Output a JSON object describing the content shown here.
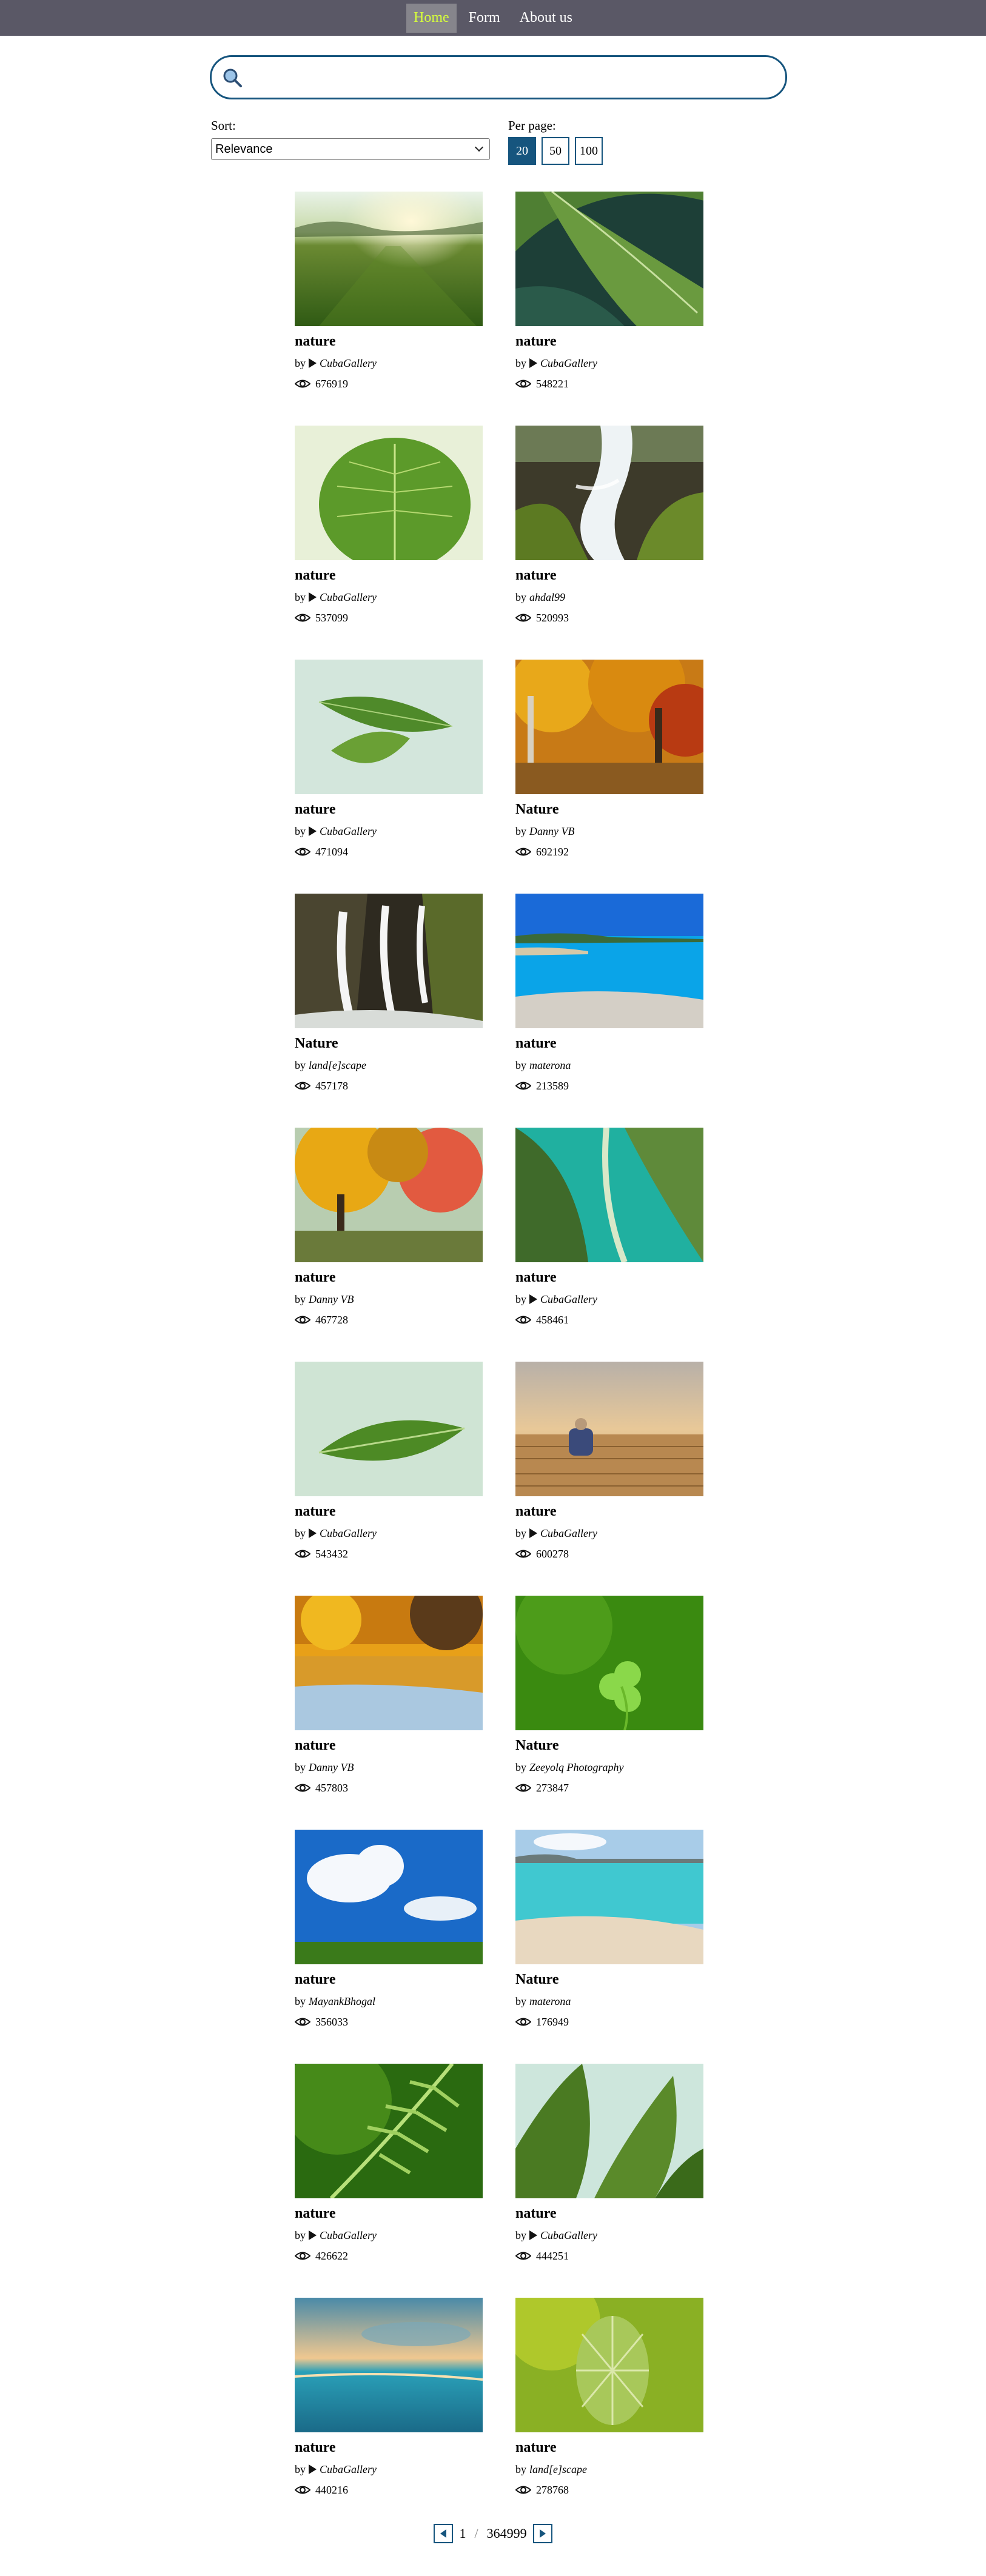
{
  "nav": {
    "items": [
      {
        "label": "Home",
        "active": true
      },
      {
        "label": "Form",
        "active": false
      },
      {
        "label": "About us",
        "active": false
      }
    ]
  },
  "search": {
    "value": "",
    "placeholder": ""
  },
  "controls": {
    "sort_label": "Sort:",
    "sort_value": "Relevance",
    "per_page_label": "Per page:",
    "per_page_options": [
      "20",
      "50",
      "100"
    ],
    "per_page_selected": "20"
  },
  "cards": [
    {
      "title": "nature",
      "by": "by",
      "author": "CubaGallery",
      "author_play_icon": true,
      "views": "676919",
      "image": "meadow-sunrise"
    },
    {
      "title": "nature",
      "by": "by",
      "author": "CubaGallery",
      "author_play_icon": true,
      "views": "548221",
      "image": "leaf-closeup-teal"
    },
    {
      "title": "nature",
      "by": "by",
      "author": "CubaGallery",
      "author_play_icon": true,
      "views": "537099",
      "image": "green-leaf-backlit"
    },
    {
      "title": "nature",
      "by": "by",
      "author": "ahdal99",
      "author_play_icon": false,
      "views": "520993",
      "image": "waterfall-mossy"
    },
    {
      "title": "nature",
      "by": "by",
      "author": "CubaGallery",
      "author_play_icon": true,
      "views": "471094",
      "image": "leaves-on-white"
    },
    {
      "title": "Nature",
      "by": "by",
      "author": "Danny VB",
      "author_play_icon": false,
      "views": "692192",
      "image": "autumn-forest"
    },
    {
      "title": "Nature",
      "by": "by",
      "author": "land[e]scape",
      "author_play_icon": false,
      "views": "457178",
      "image": "waterfalls-rock"
    },
    {
      "title": "nature",
      "by": "by",
      "author": "materona",
      "author_play_icon": false,
      "views": "213589",
      "image": "blue-sea-coast"
    },
    {
      "title": "nature",
      "by": "by",
      "author": "Danny VB",
      "author_play_icon": false,
      "views": "467728",
      "image": "autumn-park"
    },
    {
      "title": "nature",
      "by": "by",
      "author": "CubaGallery",
      "author_play_icon": true,
      "views": "458461",
      "image": "leaves-turquoise"
    },
    {
      "title": "nature",
      "by": "by",
      "author": "CubaGallery",
      "author_play_icon": true,
      "views": "543432",
      "image": "single-leaf"
    },
    {
      "title": "nature",
      "by": "by",
      "author": "CubaGallery",
      "author_play_icon": true,
      "views": "600278",
      "image": "person-on-pier"
    },
    {
      "title": "nature",
      "by": "by",
      "author": "Danny VB",
      "author_play_icon": false,
      "views": "457803",
      "image": "autumn-reflection"
    },
    {
      "title": "Nature",
      "by": "by",
      "author": "Zeeyolq Photography",
      "author_play_icon": false,
      "views": "273847",
      "image": "clover"
    },
    {
      "title": "nature",
      "by": "by",
      "author": "MayankBhogal",
      "author_play_icon": false,
      "views": "356033",
      "image": "sky-clouds-field"
    },
    {
      "title": "Nature",
      "by": "by",
      "author": "materona",
      "author_play_icon": false,
      "views": "176949",
      "image": "turquoise-beach"
    },
    {
      "title": "nature",
      "by": "by",
      "author": "CubaGallery",
      "author_play_icon": true,
      "views": "426622",
      "image": "fern"
    },
    {
      "title": "nature",
      "by": "by",
      "author": "CubaGallery",
      "author_play_icon": true,
      "views": "444251",
      "image": "green-leaves-mint"
    },
    {
      "title": "nature",
      "by": "by",
      "author": "CubaGallery",
      "author_play_icon": true,
      "views": "440216",
      "image": "sunset-sea"
    },
    {
      "title": "nature",
      "by": "by",
      "author": "land[e]scape",
      "author_play_icon": false,
      "views": "278768",
      "image": "teasel-plant"
    }
  ],
  "pagination": {
    "current": "1",
    "separator": "/",
    "total": "364999"
  },
  "icons": {
    "search": "search-icon",
    "views": "eye-icon",
    "author_badge": "play-icon",
    "prev": "prev-page-icon",
    "next": "next-page-icon"
  },
  "colors": {
    "nav_bg": "#5a5866",
    "nav_active_text": "#d7ff3a",
    "accent": "#16557e"
  }
}
